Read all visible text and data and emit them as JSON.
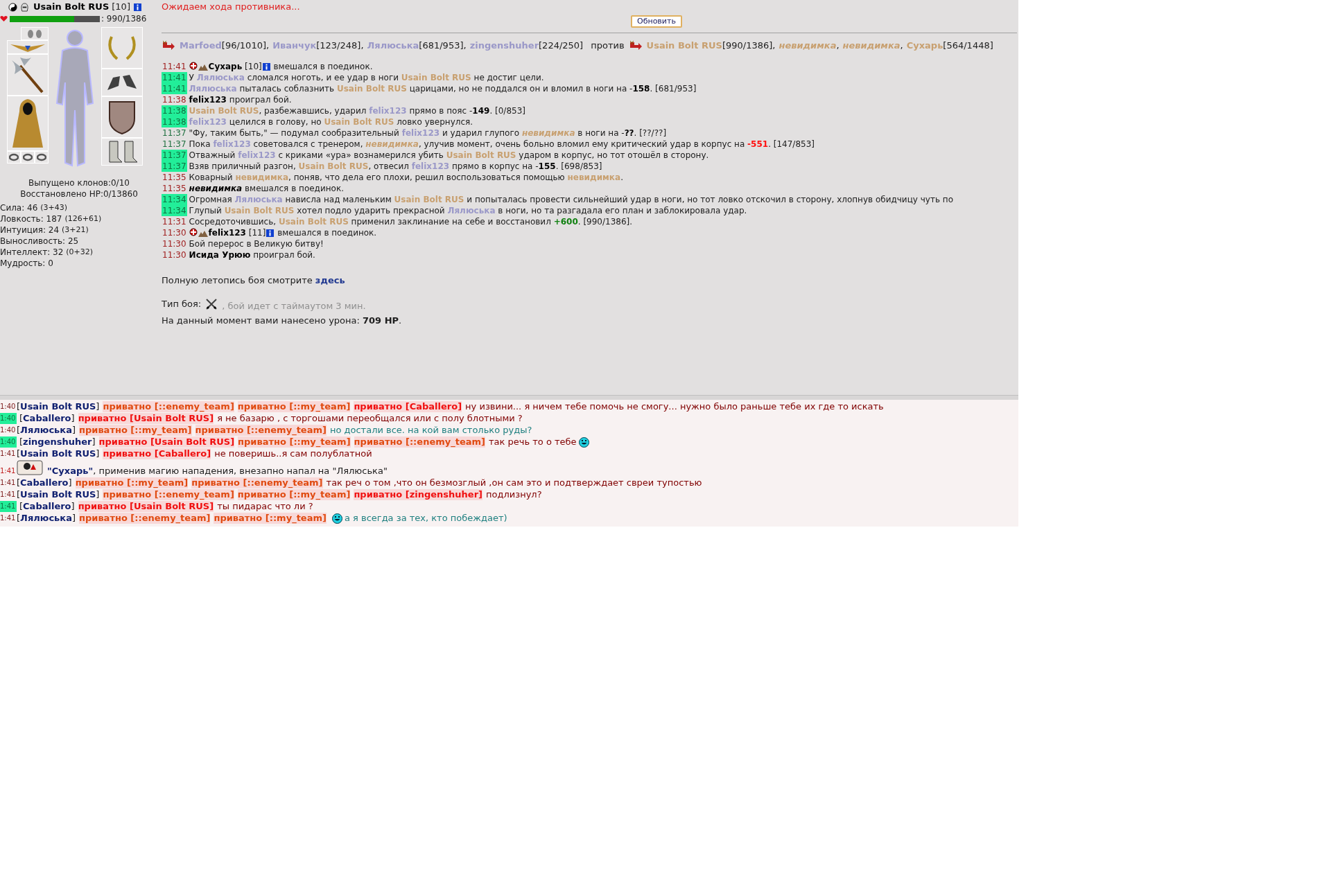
{
  "character": {
    "name": "Usain Bolt RUS",
    "level": "[10]",
    "hp": {
      "level": 0.714,
      "reading": ": 990/1386"
    },
    "clones": "Выпущено клонов:0/10",
    "restored": "Восстановлено HP:0/13860",
    "stats": [
      {
        "name": "Сила: 46",
        "bonus": "(3+43)"
      },
      {
        "name": "Ловкость: 187",
        "bonus": "(126+61)"
      },
      {
        "name": "Интуиция: 24",
        "bonus": "(3+21)"
      },
      {
        "name": "Выносливость: 25"
      },
      {
        "name": "Интеллект: 32",
        "bonus": "(0+32)"
      },
      {
        "name": "Мудрость: 0"
      }
    ]
  },
  "status": "Ожидаем хода противника...",
  "refresh_button": "Обновить",
  "teams": {
    "left": [
      {
        "name": "Marfoed",
        "hp": "[96/1010],"
      },
      {
        "name": "Иванчук",
        "hp": "[123/248],"
      },
      {
        "name": "Лялюська",
        "hp": "[681/953],"
      },
      {
        "name": "zingenshuher",
        "hp": "[224/250]"
      }
    ],
    "versus": "против",
    "right": [
      {
        "name": "Usain Bolt RUS",
        "hp": "[990/1386],",
        "hidden": false
      },
      {
        "name": "невидимка",
        "hp": ",",
        "hidden": true
      },
      {
        "name": "невидимка",
        "hp": ",",
        "hidden": true
      },
      {
        "name": "Сухарь",
        "hp": "[564/1448]",
        "hidden": false
      }
    ]
  },
  "log": [
    {
      "time": "11:41",
      "kind": "event",
      "parts": [
        {
          "kind": "joinicons"
        },
        {
          "kind": "bold",
          "text": "Сухарь"
        },
        {
          "kind": "plain",
          "text": " [10]"
        },
        {
          "kind": "info"
        },
        {
          "kind": "plain",
          "text": " вмешался в поединок."
        }
      ]
    },
    {
      "time": "11:41",
      "kind": "hit",
      "parts": [
        {
          "kind": "plain",
          "text": "У "
        },
        {
          "kind": "ally",
          "text": "Лялюська"
        },
        {
          "kind": "plain",
          "text": " сломался ноготь, и ее удар в ноги "
        },
        {
          "kind": "enemy",
          "text": "Usain Bolt RUS"
        },
        {
          "kind": "plain",
          "text": " не достиг цели."
        }
      ]
    },
    {
      "time": "11:41",
      "kind": "hit",
      "parts": [
        {
          "kind": "ally",
          "text": "Лялюська"
        },
        {
          "kind": "plain",
          "text": " пыталась соблазнить "
        },
        {
          "kind": "enemy",
          "text": "Usain Bolt RUS"
        },
        {
          "kind": "plain",
          "text": " царицами, но не поддался он и вломил в ноги на -"
        },
        {
          "kind": "bold",
          "text": "158"
        },
        {
          "kind": "plain",
          "text": ". [681/953]"
        }
      ]
    },
    {
      "time": "11:38",
      "kind": "event",
      "parts": [
        {
          "kind": "bold",
          "text": "felix123"
        },
        {
          "kind": "plain",
          "text": " проиграл бой."
        }
      ]
    },
    {
      "time": "11:38",
      "kind": "hit",
      "parts": [
        {
          "kind": "enemy",
          "text": "Usain Bolt RUS"
        },
        {
          "kind": "plain",
          "text": ", разбежавшись, ударил "
        },
        {
          "kind": "ally",
          "text": "felix123"
        },
        {
          "kind": "plain",
          "text": " прямо в пояс -"
        },
        {
          "kind": "bold",
          "text": "149"
        },
        {
          "kind": "plain",
          "text": ". [0/853]"
        }
      ]
    },
    {
      "time": "11:38",
      "kind": "hit",
      "parts": [
        {
          "kind": "ally",
          "text": "felix123"
        },
        {
          "kind": "plain",
          "text": " целился в голову, но "
        },
        {
          "kind": "enemy",
          "text": "Usain Bolt RUS"
        },
        {
          "kind": "plain",
          "text": " ловко увернулся."
        }
      ]
    },
    {
      "time": "11:37",
      "kind": "other",
      "parts": [
        {
          "kind": "plain",
          "text": "\"Фу, таким быть,\" — подумал сообразительный "
        },
        {
          "kind": "ally",
          "text": "felix123"
        },
        {
          "kind": "plain",
          "text": " и ударил глупого "
        },
        {
          "kind": "hidden",
          "text": "невидимка"
        },
        {
          "kind": "plain",
          "text": " в ноги на -"
        },
        {
          "kind": "bold",
          "text": "??"
        },
        {
          "kind": "plain",
          "text": ". [??/??]"
        }
      ]
    },
    {
      "time": "11:37",
      "kind": "other",
      "parts": [
        {
          "kind": "plain",
          "text": "Пока "
        },
        {
          "kind": "ally",
          "text": "felix123"
        },
        {
          "kind": "plain",
          "text": " советовался с тренером, "
        },
        {
          "kind": "hidden",
          "text": "невидимка"
        },
        {
          "kind": "plain",
          "text": ", улучив момент, очень больно вломил ему критический удар в корпус на "
        },
        {
          "kind": "crit",
          "text": "-551"
        },
        {
          "kind": "plain",
          "text": ". [147/853]"
        }
      ]
    },
    {
      "time": "11:37",
      "kind": "hit",
      "parts": [
        {
          "kind": "plain",
          "text": "Отважный "
        },
        {
          "kind": "ally",
          "text": "felix123"
        },
        {
          "kind": "plain",
          "text": " с криками «ура» вознамерился убить "
        },
        {
          "kind": "enemy",
          "text": "Usain Bolt RUS"
        },
        {
          "kind": "plain",
          "text": " ударом в корпус, но тот отошёл в сторону."
        }
      ]
    },
    {
      "time": "11:37",
      "kind": "hit",
      "parts": [
        {
          "kind": "plain",
          "text": "Взяв приличный разгон, "
        },
        {
          "kind": "enemy",
          "text": "Usain Bolt RUS"
        },
        {
          "kind": "plain",
          "text": ", отвесил "
        },
        {
          "kind": "ally",
          "text": "felix123"
        },
        {
          "kind": "plain",
          "text": " прямо в корпус на -"
        },
        {
          "kind": "bold",
          "text": "155"
        },
        {
          "kind": "plain",
          "text": ". [698/853]"
        }
      ]
    },
    {
      "time": "11:35",
      "kind": "event",
      "parts": [
        {
          "kind": "plain",
          "text": "Коварный "
        },
        {
          "kind": "enemy",
          "text": "невидимка"
        },
        {
          "kind": "plain",
          "text": ", поняв, что дела его плохи, решил воспользоваться помощью "
        },
        {
          "kind": "enemy",
          "text": "невидимка"
        },
        {
          "kind": "plain",
          "text": "."
        }
      ]
    },
    {
      "time": "11:35",
      "kind": "event",
      "parts": [
        {
          "kind": "bolditalic",
          "text": "невидимка"
        },
        {
          "kind": "plain",
          "text": " вмешался в поединок."
        }
      ]
    },
    {
      "time": "11:34",
      "kind": "hit",
      "parts": [
        {
          "kind": "plain",
          "text": "Огромная "
        },
        {
          "kind": "ally",
          "text": "Лялюська"
        },
        {
          "kind": "plain",
          "text": " нависла над маленьким "
        },
        {
          "kind": "enemy",
          "text": "Usain Bolt RUS"
        },
        {
          "kind": "plain",
          "text": " и попыталась провести сильнейший удар в ноги, но тот ловко отскочил в сторону, хлопнув обидчицу чуть по"
        }
      ]
    },
    {
      "time": "11:34",
      "kind": "hit",
      "parts": [
        {
          "kind": "plain",
          "text": "Глупый "
        },
        {
          "kind": "enemy",
          "text": "Usain Bolt RUS"
        },
        {
          "kind": "plain",
          "text": " хотел подло ударить прекрасной "
        },
        {
          "kind": "ally",
          "text": "Лялюська"
        },
        {
          "kind": "plain",
          "text": " в ноги, но та разгадала его план и заблокировала удар."
        }
      ]
    },
    {
      "time": "11:31",
      "kind": "event",
      "parts": [
        {
          "kind": "plain",
          "text": "Сосредоточившись, "
        },
        {
          "kind": "enemy",
          "text": "Usain Bolt RUS"
        },
        {
          "kind": "plain",
          "text": " применил заклинание на себе и восстановил "
        },
        {
          "kind": "heal",
          "text": "+600"
        },
        {
          "kind": "plain",
          "text": ". [990/1386]."
        }
      ]
    },
    {
      "time": "11:30",
      "kind": "event",
      "parts": [
        {
          "kind": "joinicons"
        },
        {
          "kind": "bold",
          "text": "felix123"
        },
        {
          "kind": "plain",
          "text": " [11]"
        },
        {
          "kind": "info"
        },
        {
          "kind": "plain",
          "text": " вмешался в поединок."
        }
      ]
    },
    {
      "time": "11:30",
      "kind": "event",
      "parts": [
        {
          "kind": "plain",
          "text": "Бой перерос в Великую битву!"
        }
      ]
    },
    {
      "time": "11:30",
      "kind": "event",
      "parts": [
        {
          "kind": "bold",
          "text": "Исида Урюю"
        },
        {
          "kind": "plain",
          "text": " проиграл бой."
        }
      ]
    }
  ],
  "chronicle": {
    "text": "Полную летопись боя смотрите",
    "link": "здесь"
  },
  "fight_type": {
    "label": "Тип боя:",
    "text": ", бой идет с таймаутом 3 мин."
  },
  "damage": "На данный момент вами нанесено урона: **709 HP**.",
  "chat": [
    {
      "kind": "message",
      "time": "1:40",
      "highlight": false,
      "sender": "[**Usain Bolt RUS**]",
      "privates": [
        {
          "kind": "team",
          "text": "приватно [::enemy_team]"
        },
        {
          "kind": "team",
          "text": "приватно [::my_team]"
        },
        {
          "kind": "person",
          "text": "приватно [Caballero]"
        }
      ],
      "message": "ну извини... я ничем тебе помочь не смогу... нужно было раньше тебе их где то искать",
      "color": "#800000"
    },
    {
      "kind": "message",
      "time": "1:40",
      "highlight": true,
      "sender": "[**Caballero**]",
      "privates": [
        {
          "kind": "person",
          "text": "приватно [Usain Bolt RUS]"
        }
      ],
      "message": "я не базарю , с торгошами переобщался или с полу блотными ?",
      "color": "#800000"
    },
    {
      "kind": "message",
      "time": "1:40",
      "highlight": false,
      "sender": "[**Лялюська**]",
      "privates": [
        {
          "kind": "team",
          "text": "приватно [::my_team]"
        },
        {
          "kind": "team",
          "text": "приватно [::enemy_team]"
        }
      ],
      "message": "но достали все. на кой вам столько руды?",
      "color": "#208080"
    },
    {
      "kind": "message",
      "time": "1:40",
      "highlight": true,
      "sender": "[**zingenshuher**]",
      "privates": [
        {
          "kind": "person",
          "text": "приватно [Usain Bolt RUS]"
        },
        {
          "kind": "team",
          "text": "приватно [::my_team]"
        },
        {
          "kind": "team",
          "text": "приватно [::enemy_team]"
        }
      ],
      "message": "так речь то о тебе",
      "color": "#800000",
      "smiley_after": true
    },
    {
      "kind": "message",
      "time": "1:41",
      "highlight": false,
      "sender": "[**Usain Bolt RUS**]",
      "privates": [
        {
          "kind": "person",
          "text": "приватно [Caballero]"
        }
      ],
      "message": "не поверишь..я сам полублатной",
      "color": "#800000"
    },
    {
      "kind": "system",
      "time": "1:41",
      "text": "**\"Сухарь\"**, применив магию нападения, внезапно напал на \"Лялюська\""
    },
    {
      "kind": "message",
      "time": "1:41",
      "highlight": false,
      "sender": "[**Caballero**]",
      "privates": [
        {
          "kind": "team",
          "text": "приватно [::my_team]"
        },
        {
          "kind": "team",
          "text": "приватно [::enemy_team]"
        }
      ],
      "message": "так реч о том ,что он безмозглый ,он сам это и подтверждает свреи тупостью",
      "color": "#800000"
    },
    {
      "kind": "message",
      "time": "1:41",
      "highlight": false,
      "sender": "[**Usain Bolt RUS**]",
      "privates": [
        {
          "kind": "team",
          "text": "приватно [::enemy_team]"
        },
        {
          "kind": "team",
          "text": "приватно [::my_team]"
        },
        {
          "kind": "person",
          "text": "приватно [zingenshuher]"
        }
      ],
      "message": "подлизнул?",
      "color": "#800000"
    },
    {
      "kind": "message",
      "time": "1:41",
      "highlight": true,
      "sender": "[**Caballero**]",
      "privates": [
        {
          "kind": "person",
          "text": "приватно [Usain Bolt RUS]"
        }
      ],
      "message": "ты пидарас что ли ?",
      "color": "#800000"
    },
    {
      "kind": "message",
      "time": "1:41",
      "highlight": false,
      "sender": "[**Лялюська**]",
      "privates": [
        {
          "kind": "team",
          "text": "приватно [::enemy_team]"
        },
        {
          "kind": "team",
          "text": "приватно [::my_team]"
        }
      ],
      "message": "а я всегда за тех, кто побеждает)",
      "color": "#208080",
      "smiley_before": true
    }
  ]
}
